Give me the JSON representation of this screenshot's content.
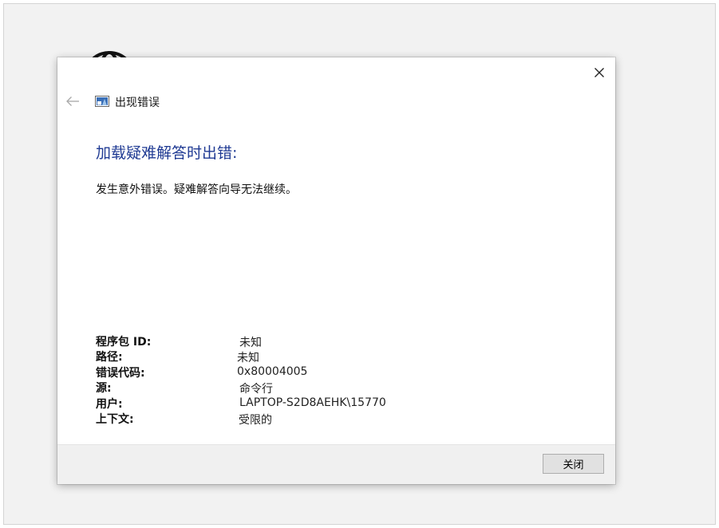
{
  "dialog": {
    "title": "出现错误",
    "heading": "加载疑难解答时出错:",
    "message": "发生意外错误。疑难解答向导无法继续。",
    "details": [
      {
        "label": "程序包 ID:",
        "value": "未知"
      },
      {
        "label": "路径:",
        "value": "未知"
      },
      {
        "label": "错误代码:",
        "value": "0x80004005"
      },
      {
        "label": "源:",
        "value": "命令行"
      },
      {
        "label": "用户:",
        "value": "LAPTOP-S2D8AEHK\\15770"
      },
      {
        "label": "上下文:",
        "value": "受限的"
      }
    ],
    "close_button_label": "关闭"
  },
  "icons": {
    "close": "close-icon",
    "back": "back-arrow-icon",
    "troubleshooter": "troubleshooter-icon",
    "globe": "globe-icon"
  },
  "colors": {
    "heading": "#1f3a93",
    "footer_bg": "#f0f0f0",
    "background_window": "#f2f2f2"
  }
}
